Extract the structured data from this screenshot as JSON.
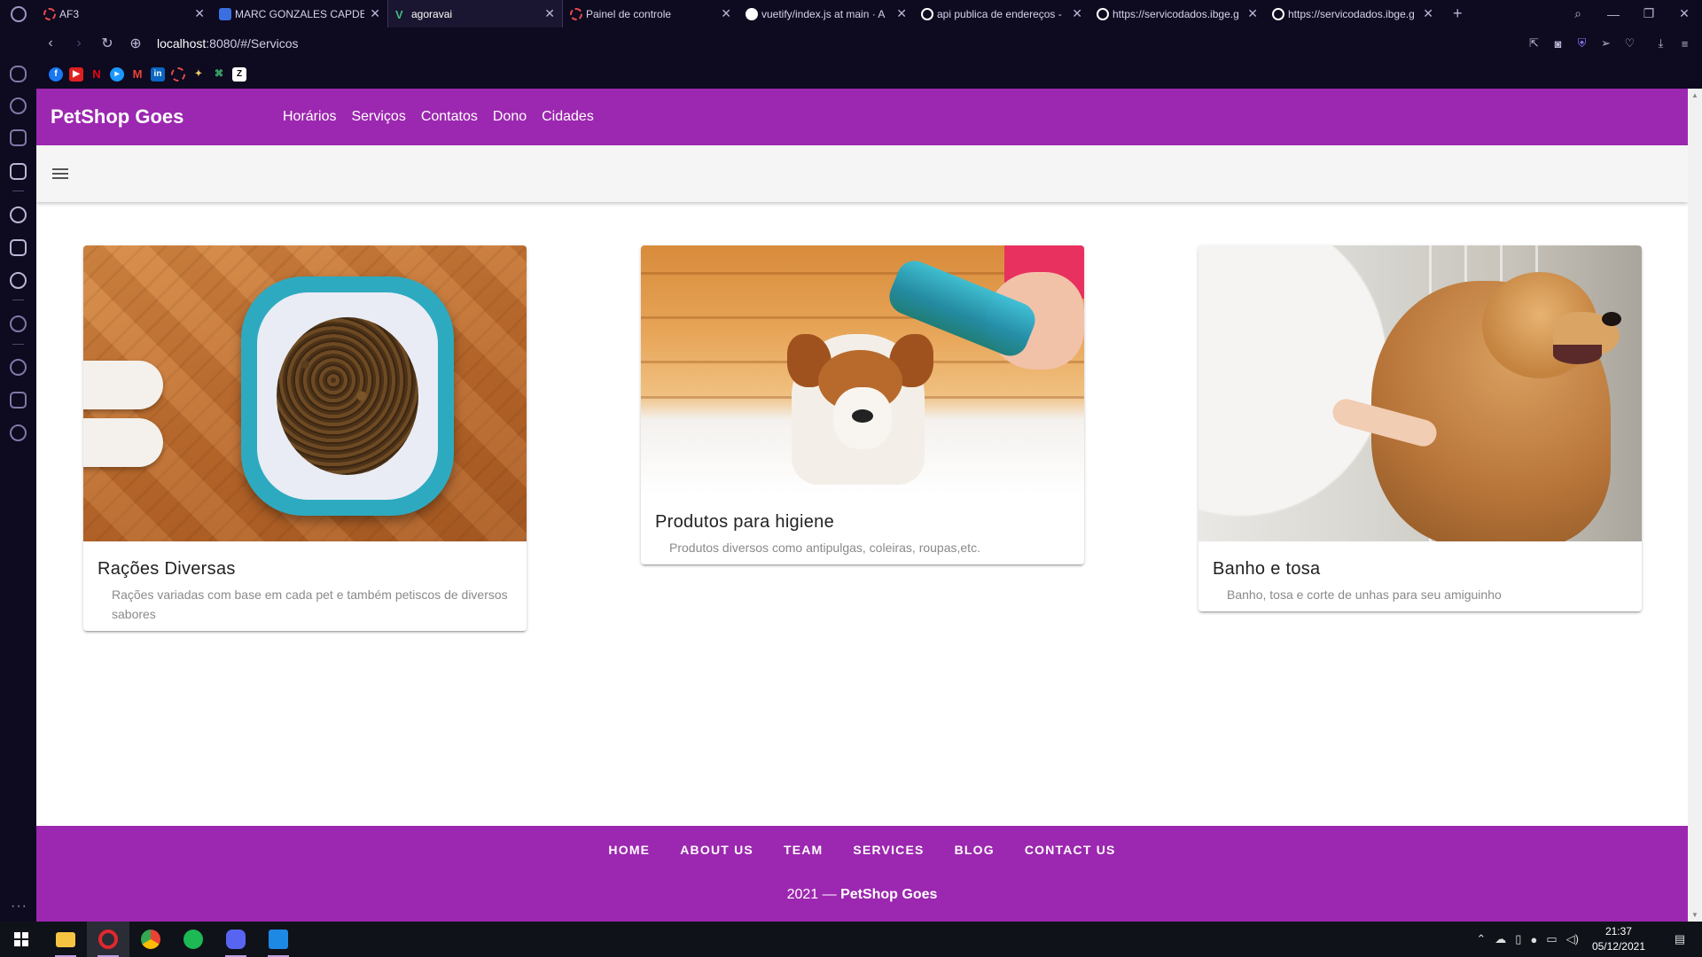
{
  "browser": {
    "tabs": [
      {
        "title": "AF3",
        "favicon_color": "#e24a4a",
        "active": false
      },
      {
        "title": "MARC GONZALES CAPDEV",
        "favicon_color": "#3b6fe0",
        "active": false
      },
      {
        "title": "agoravai",
        "favicon_color": "#42b883",
        "active": true
      },
      {
        "title": "Painel de controle",
        "favicon_color": "#e24a4a",
        "active": false
      },
      {
        "title": "vuetify/index.js at main · A",
        "favicon_color": "#ffffff",
        "active": false
      },
      {
        "title": "api publica de endereços -",
        "favicon_color": "#ffffff",
        "active": false
      },
      {
        "title": "https://servicodados.ibge.g",
        "favicon_color": "#ffffff",
        "active": false
      },
      {
        "title": "https://servicodados.ibge.g",
        "favicon_color": "#ffffff",
        "active": false
      }
    ],
    "url_host": "localhost",
    "url_rest": ":8080/#/Servicos"
  },
  "app": {
    "brand": "PetShop Goes",
    "nav": [
      "Horários",
      "Serviços",
      "Contatos",
      "Dono",
      "Cidades"
    ],
    "accent_color": "#9c27b0"
  },
  "cards": [
    {
      "title": "Rações Diversas",
      "subtitle": "Rações variadas com base em cada pet e também petiscos de diversos sabores"
    },
    {
      "title": "Produtos para higiene",
      "subtitle": "Produtos diversos como antipulgas, coleiras, roupas,etc."
    },
    {
      "title": "Banho e tosa",
      "subtitle": "Banho, tosa e corte de unhas para seu amiguinho"
    }
  ],
  "footer": {
    "links": [
      "HOME",
      "ABOUT US",
      "TEAM",
      "SERVICES",
      "BLOG",
      "CONTACT US"
    ],
    "year_prefix": "2021 —",
    "brand": "PetShop Goes"
  },
  "taskbar": {
    "time": "21:37",
    "date": "05/12/2021"
  }
}
